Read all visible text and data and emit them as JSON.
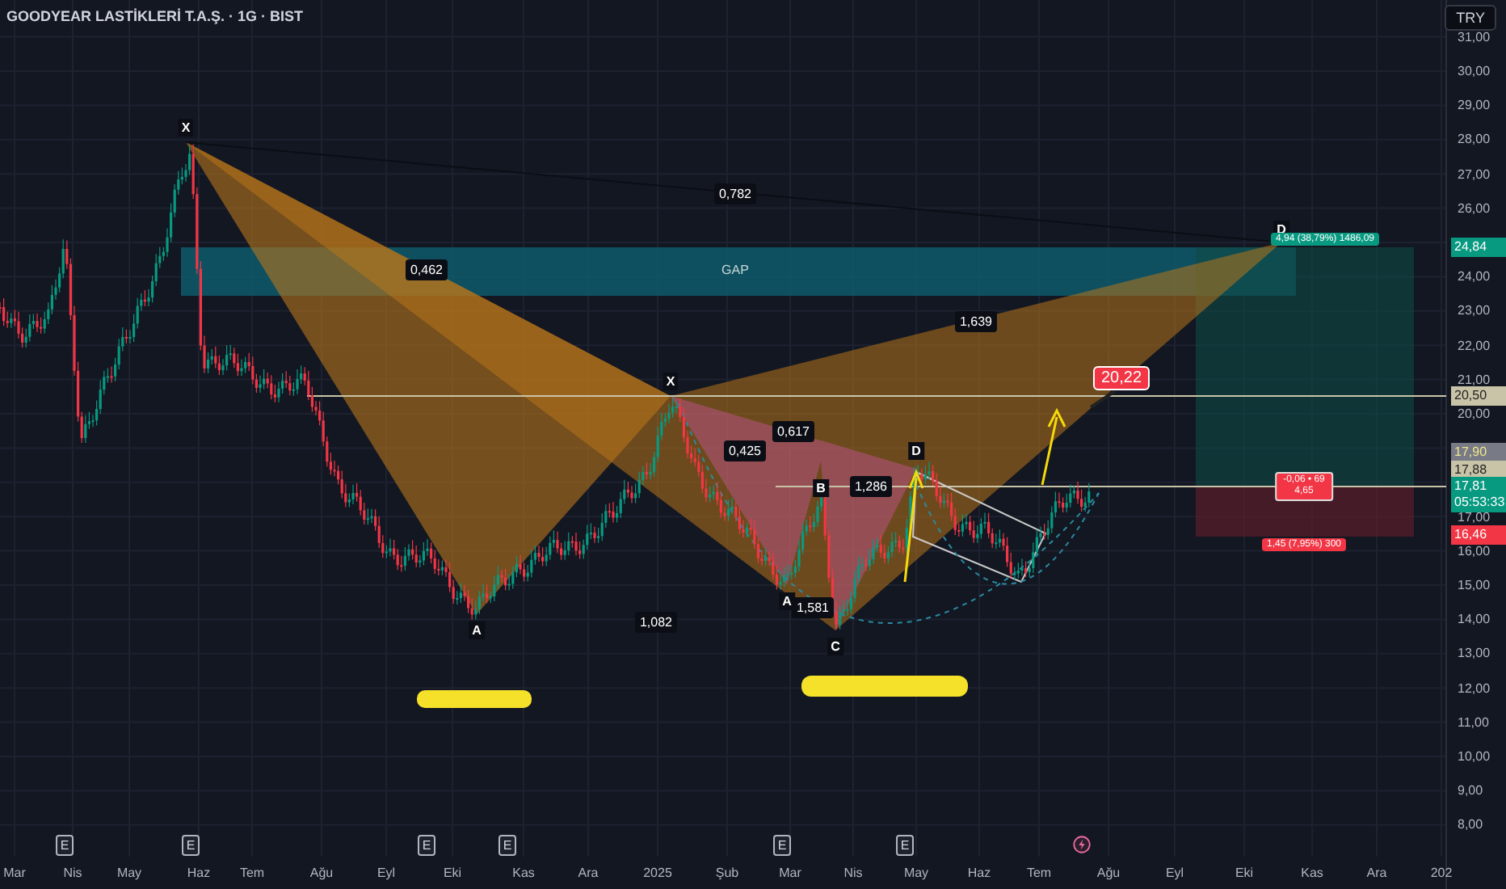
{
  "header": {
    "title": "GOODYEAR LASTİKLERİ T.A.Ş. · 1G · BIST"
  },
  "currency_button": {
    "label": "TRY"
  },
  "price_axis": {
    "labels": [
      "31,00",
      "30,00",
      "29,00",
      "28,00",
      "27,00",
      "26,00",
      "24,00",
      "23,00",
      "22,00",
      "21,00",
      "20,00",
      "17,00",
      "16,00",
      "15,00",
      "14,00",
      "13,00",
      "12,00",
      "11,00",
      "10,00",
      "9,00",
      "8,00"
    ]
  },
  "price_tags": [
    {
      "kind": "target",
      "text": "24,84"
    },
    {
      "kind": "level",
      "text": "20,50"
    },
    {
      "kind": "alert",
      "text": "17,90"
    },
    {
      "kind": "level",
      "text": "17,88"
    },
    {
      "kind": "current",
      "text": "17,81",
      "time": "05:53:33"
    },
    {
      "kind": "stop",
      "text": "16,46"
    }
  ],
  "time_axis": {
    "labels": [
      "Mar",
      "Nis",
      "May",
      "Haz",
      "Tem",
      "Ağu",
      "Eyl",
      "Eki",
      "Kas",
      "Ara",
      "2025",
      "Şub",
      "Mar",
      "Nis",
      "May",
      "Haz",
      "Tem",
      "Ağu",
      "Eyl",
      "Eki",
      "Kas",
      "Ara",
      "202"
    ]
  },
  "events": [
    {
      "kind": "earnings",
      "label": "E"
    },
    {
      "kind": "earnings",
      "label": "E"
    },
    {
      "kind": "earnings",
      "label": "E"
    },
    {
      "kind": "earnings",
      "label": "E"
    },
    {
      "kind": "earnings",
      "label": "E"
    },
    {
      "kind": "earnings",
      "label": "E"
    },
    {
      "kind": "flash"
    }
  ],
  "pattern_points": [
    "X",
    "A",
    "X",
    "A",
    "B",
    "C",
    "D",
    "D"
  ],
  "ratios": [
    "0,782",
    "0,462",
    "1,639",
    "0,425",
    "0,617",
    "1,286",
    "1,581",
    "1,082"
  ],
  "gap": {
    "label": "GAP"
  },
  "target_label": {
    "text": "20,22"
  },
  "position": {
    "profit_label": "4,94 (38,79%) 1486,09",
    "open_label": "-0,06 • 69",
    "open_sub": "4,65",
    "loss_label": "1,45 (7,95%) 300"
  }
}
